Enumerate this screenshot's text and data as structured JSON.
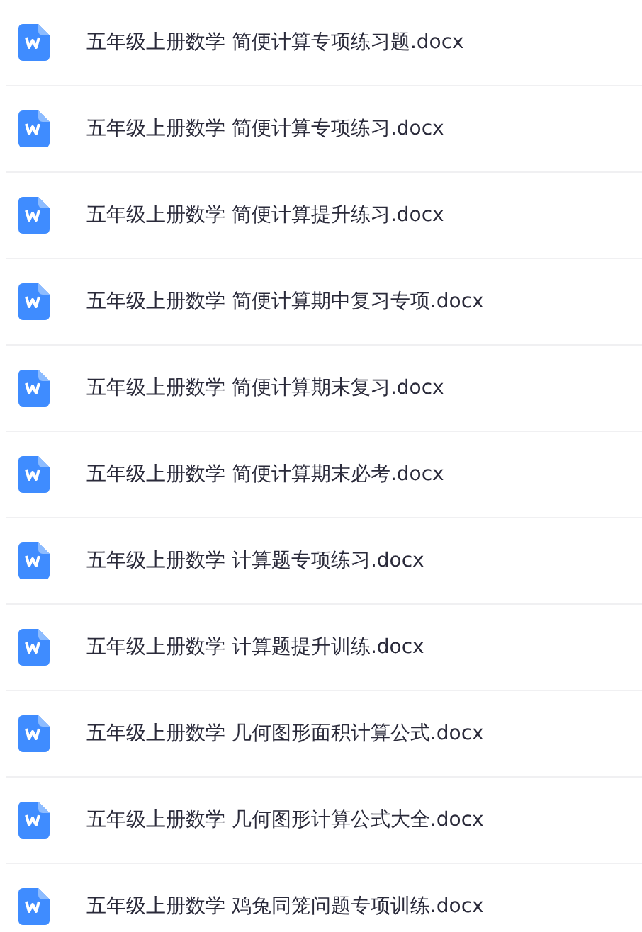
{
  "files": [
    {
      "name": "五年级上册数学 简便计算专项练习题.docx"
    },
    {
      "name": "五年级上册数学 简便计算专项练习.docx"
    },
    {
      "name": "五年级上册数学 简便计算提升练习.docx"
    },
    {
      "name": "五年级上册数学 简便计算期中复习专项.docx"
    },
    {
      "name": "五年级上册数学 简便计算期末复习.docx"
    },
    {
      "name": "五年级上册数学 简便计算期末必考.docx"
    },
    {
      "name": "五年级上册数学 计算题专项练习.docx"
    },
    {
      "name": "五年级上册数学 计算题提升训练.docx"
    },
    {
      "name": "五年级上册数学 几何图形面积计算公式.docx"
    },
    {
      "name": "五年级上册数学 几何图形计算公式大全.docx"
    },
    {
      "name": "五年级上册数学 鸡兔同笼问题专项训练.docx"
    }
  ]
}
